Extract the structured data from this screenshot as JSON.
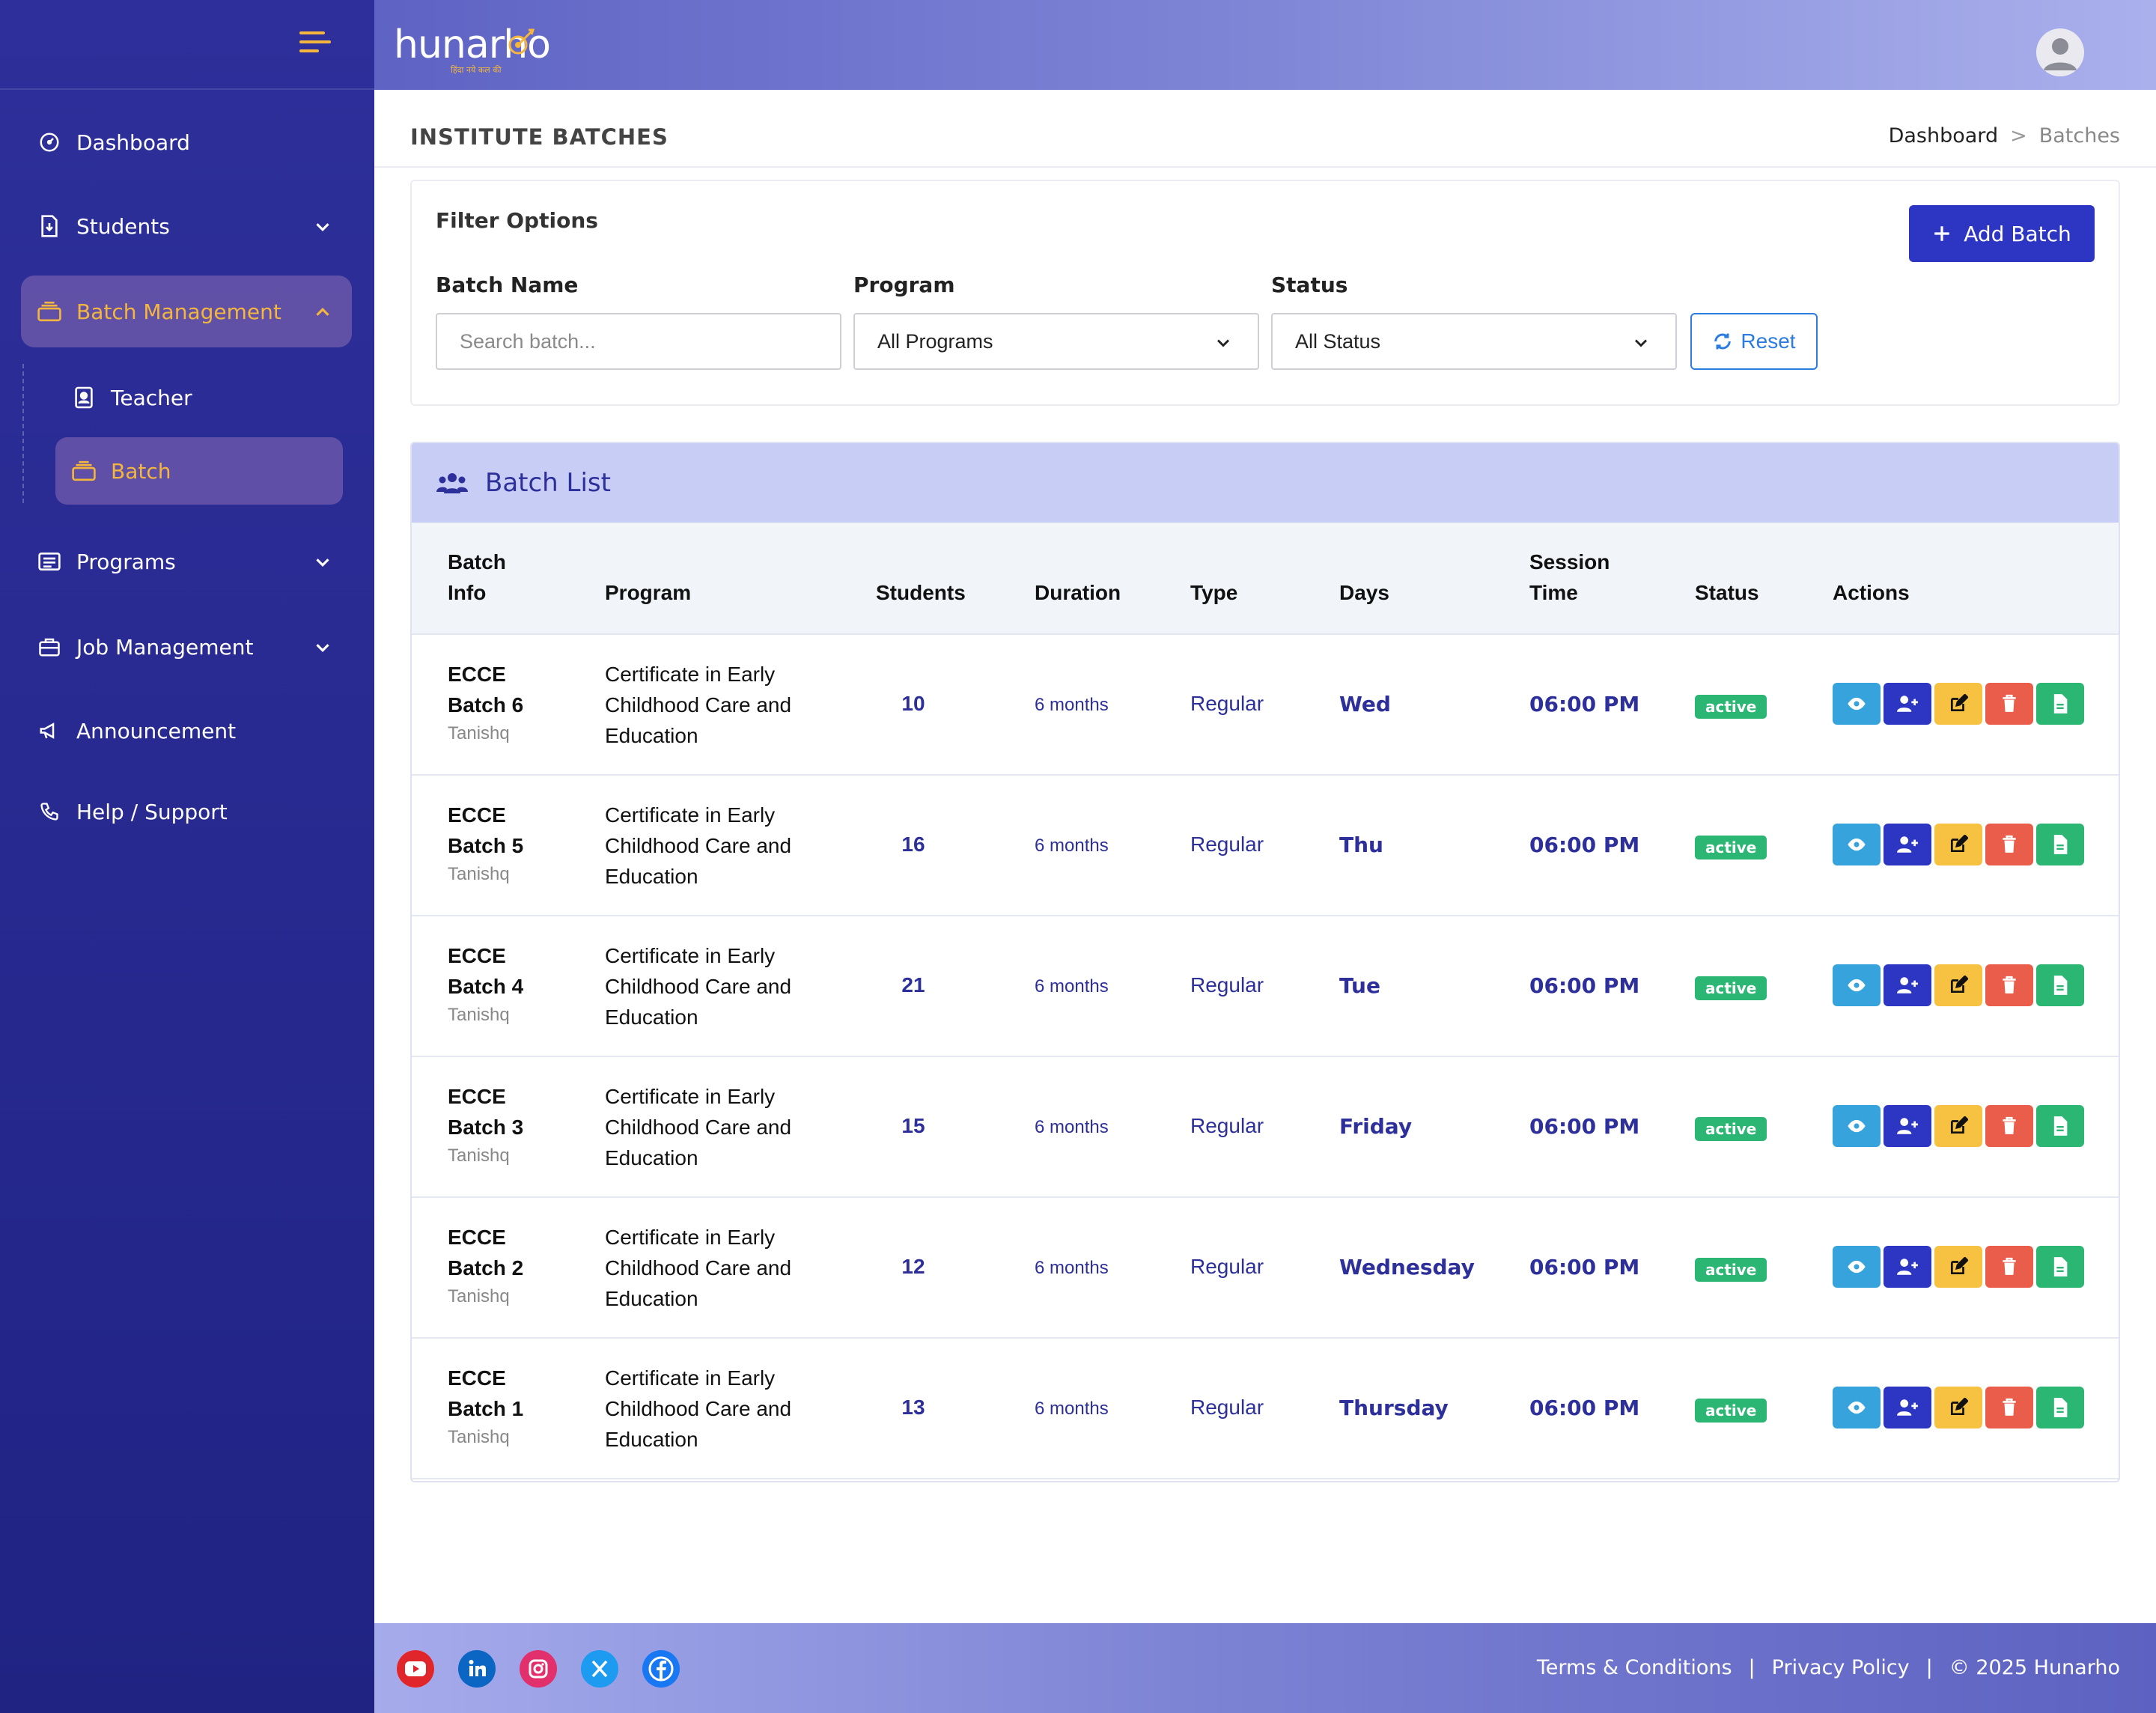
{
  "brand": {
    "name": "hunarho",
    "tagline": "हिंदा नये कल की"
  },
  "sidebar": {
    "items": [
      {
        "label": "Dashboard",
        "icon": "dashboard-icon"
      },
      {
        "label": "Students",
        "icon": "student-file-icon"
      },
      {
        "label": "Batch Management",
        "icon": "batch-stack-icon",
        "active": true
      },
      {
        "label": "Programs",
        "icon": "programs-list-icon"
      },
      {
        "label": "Job Management",
        "icon": "briefcase-icon"
      },
      {
        "label": "Announcement",
        "icon": "megaphone-icon"
      },
      {
        "label": "Help / Support",
        "icon": "phone-icon"
      }
    ],
    "subitems": [
      {
        "label": "Teacher",
        "icon": "teacher-badge-icon"
      },
      {
        "label": "Batch",
        "icon": "batch-stack-icon",
        "active": true
      }
    ]
  },
  "page": {
    "title": "INSTITUTE BATCHES",
    "breadcrumb": {
      "home": "Dashboard",
      "separator": ">",
      "current": "Batches"
    }
  },
  "filters": {
    "title": "Filter Options",
    "add_button": "Add Batch",
    "batch_name_label": "Batch Name",
    "batch_name_placeholder": "Search batch...",
    "program_label": "Program",
    "program_value": "All Programs",
    "status_label": "Status",
    "status_value": "All Status",
    "reset_button": "Reset"
  },
  "batch_list": {
    "title": "Batch List",
    "columns": {
      "batch_info_1": "Batch",
      "batch_info_2": "Info",
      "program": "Program",
      "students": "Students",
      "duration": "Duration",
      "type": "Type",
      "days": "Days",
      "session_1": "Session",
      "session_2": "Time",
      "status": "Status",
      "actions": "Actions"
    },
    "rows": [
      {
        "name_1": "ECCE",
        "name_2": "Batch 6",
        "institute": "Tanishq",
        "program_1": "Certificate in Early",
        "program_2": "Childhood Care and",
        "program_3": "Education",
        "students": "10",
        "duration": "6 months",
        "type": "Regular",
        "days": "Wed",
        "time": "06:00 PM",
        "status": "active"
      },
      {
        "name_1": "ECCE",
        "name_2": "Batch 5",
        "institute": "Tanishq",
        "program_1": "Certificate in Early",
        "program_2": "Childhood Care and",
        "program_3": "Education",
        "students": "16",
        "duration": "6 months",
        "type": "Regular",
        "days": "Thu",
        "time": "06:00 PM",
        "status": "active"
      },
      {
        "name_1": "ECCE",
        "name_2": "Batch 4",
        "institute": "Tanishq",
        "program_1": "Certificate in Early",
        "program_2": "Childhood Care and",
        "program_3": "Education",
        "students": "21",
        "duration": "6 months",
        "type": "Regular",
        "days": "Tue",
        "time": "06:00 PM",
        "status": "active"
      },
      {
        "name_1": "ECCE",
        "name_2": "Batch 3",
        "institute": "Tanishq",
        "program_1": "Certificate in Early",
        "program_2": "Childhood Care and",
        "program_3": "Education",
        "students": "15",
        "duration": "6 months",
        "type": "Regular",
        "days": "Friday",
        "time": "06:00 PM",
        "status": "active"
      },
      {
        "name_1": "ECCE",
        "name_2": "Batch 2",
        "institute": "Tanishq",
        "program_1": "Certificate in Early",
        "program_2": "Childhood Care and",
        "program_3": "Education",
        "students": "12",
        "duration": "6 months",
        "type": "Regular",
        "days": "Wednesday",
        "time": "06:00 PM",
        "status": "active"
      },
      {
        "name_1": "ECCE",
        "name_2": "Batch 1",
        "institute": "Tanishq",
        "program_1": "Certificate in Early",
        "program_2": "Childhood Care and",
        "program_3": "Education",
        "students": "13",
        "duration": "6 months",
        "type": "Regular",
        "days": "Thursday",
        "time": "06:00 PM",
        "status": "active"
      }
    ]
  },
  "footer": {
    "socials": [
      "youtube-icon",
      "linkedin-icon",
      "instagram-icon",
      "x-twitter-icon",
      "facebook-icon"
    ],
    "terms": "Terms & Conditions",
    "separator": "|",
    "privacy": "Privacy Policy",
    "copyright": "© 2025 Hunarho"
  },
  "colors": {
    "sidebar": "#2e2f9a",
    "accent": "#f4b63c",
    "primary": "#2d35c3",
    "status_active": "#2bb673"
  }
}
